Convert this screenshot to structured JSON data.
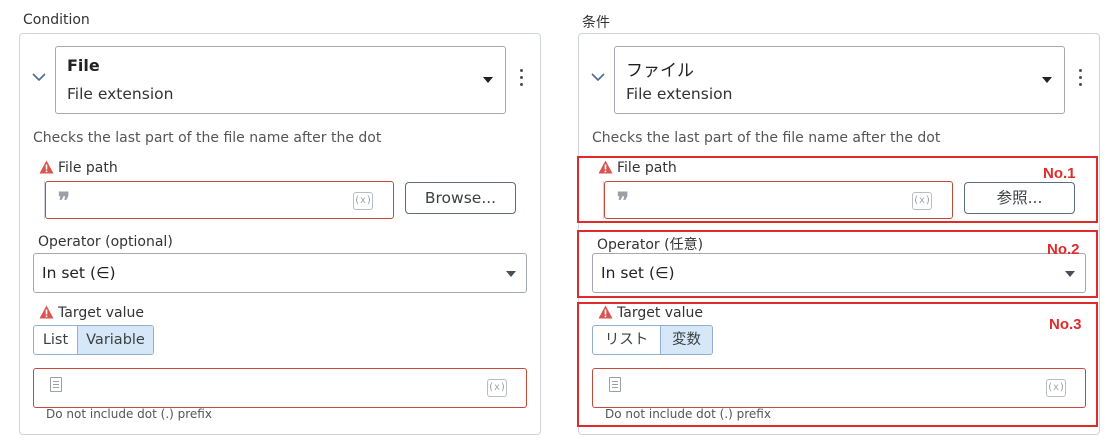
{
  "left": {
    "panel_title": "Condition",
    "selector": {
      "main": "File",
      "sub": "File extension"
    },
    "description": "Checks the last part of the file name after the dot",
    "file_path": {
      "label": "File path",
      "browse": "Browse..."
    },
    "operator": {
      "label": "Operator (optional)",
      "value": "In set (∈)"
    },
    "target_value": {
      "label": "Target value",
      "segments": [
        "List",
        "Variable"
      ],
      "active_segment": "Variable",
      "hint": "Do not include dot (.) prefix"
    }
  },
  "right": {
    "panel_title": "条件",
    "selector": {
      "main": "ファイル",
      "sub": "File extension"
    },
    "description": "Checks the last part of the file name after the dot",
    "file_path": {
      "label": "File path",
      "browse": "参照..."
    },
    "operator": {
      "label": "Operator (任意)",
      "value": "In set (∈)"
    },
    "target_value": {
      "label": "Target value",
      "segments": [
        "リスト",
        "変数"
      ],
      "active_segment": "変数",
      "hint": "Do not include dot (.) prefix"
    }
  },
  "icons": {
    "variable_icon_text": "(x)",
    "quote_glyph": "❞",
    "chevron": "chevron-down-icon",
    "kebab": "more-vertical-icon",
    "warning": "warning-icon"
  },
  "annotations": {
    "labels": [
      "No.1",
      "No.2",
      "No.3"
    ],
    "color": "#e02b2b"
  },
  "colors": {
    "error_border": "#c44a3a",
    "segment_active": "#d6e8f8",
    "warning": "#d9534f"
  }
}
